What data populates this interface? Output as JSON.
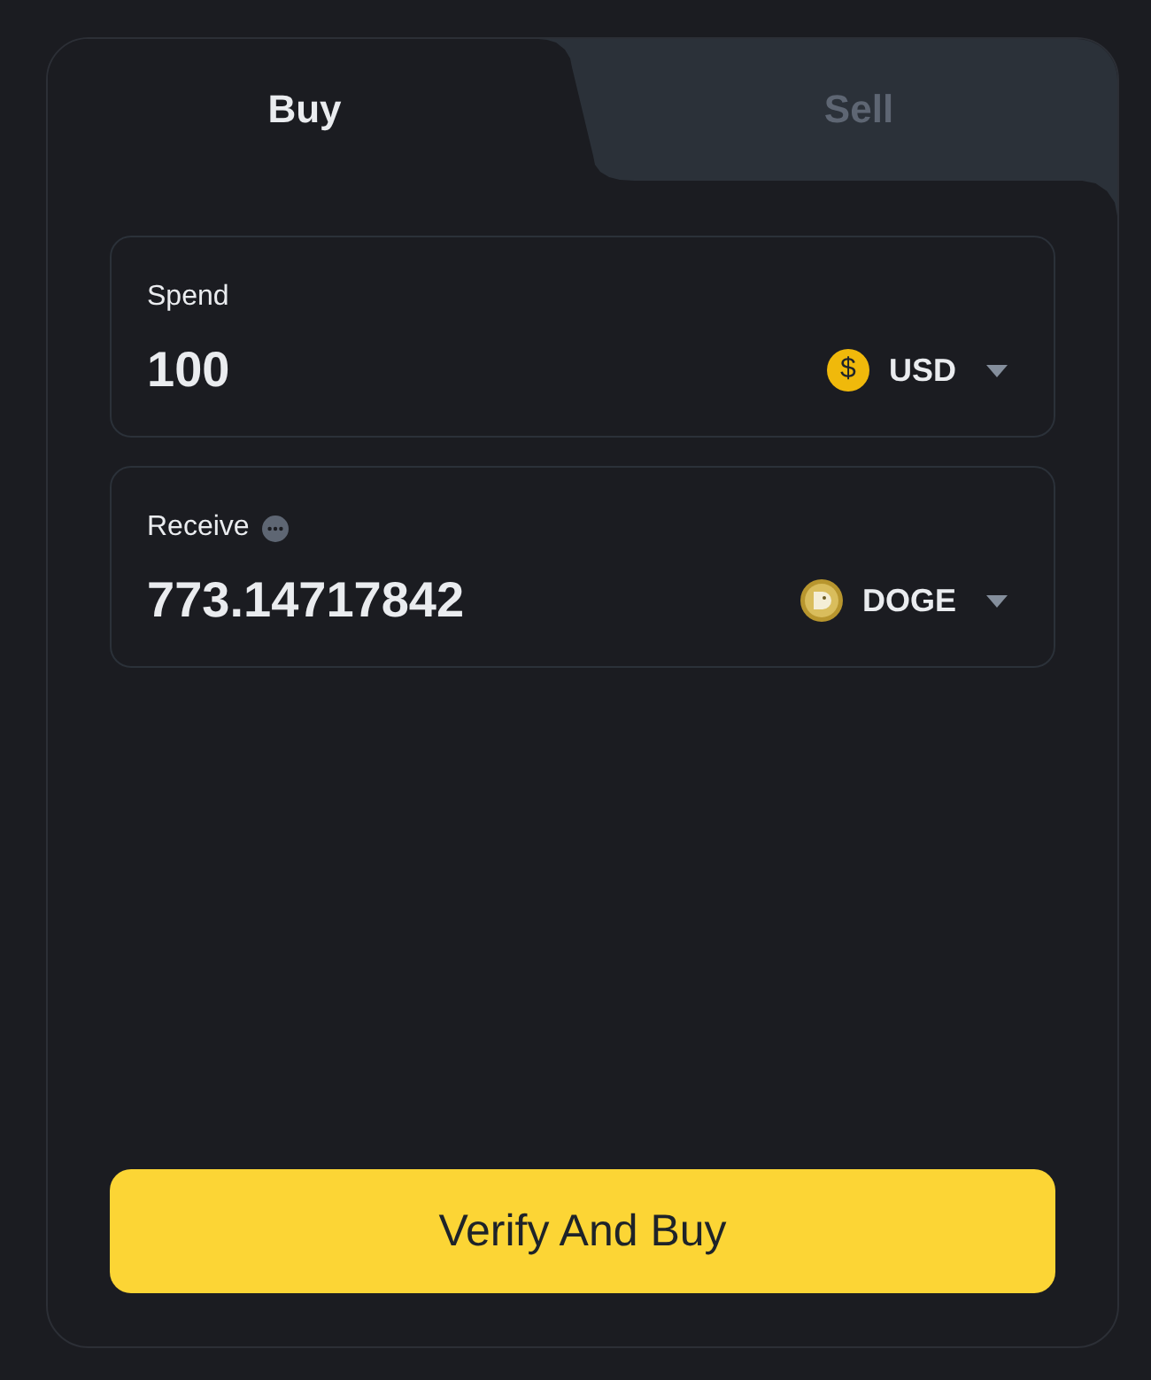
{
  "tabs": [
    {
      "label": "Buy",
      "selected": true
    },
    {
      "label": "Sell",
      "selected": false
    }
  ],
  "fields": [
    {
      "label": "Spend",
      "info": false,
      "value": "100",
      "currency": {
        "kind": "fiat",
        "symbol": "$",
        "code": "USD"
      }
    },
    {
      "label": "Receive",
      "info": true,
      "value": "773.14717842",
      "currency": {
        "kind": "crypto",
        "code": "DOGE"
      }
    }
  ],
  "submit": {
    "label": "Verify And Buy"
  }
}
